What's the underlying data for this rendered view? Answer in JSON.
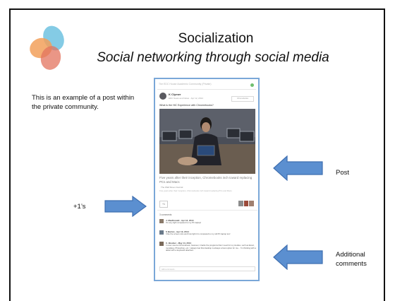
{
  "slide": {
    "title": "Socialization",
    "subtitle": "Social networking through social media",
    "description": "This is an example of a post within the private community.",
    "labels": {
      "post": "Post",
      "plus_ones": "+1’s",
      "additional_comments_line1": "Additional",
      "additional_comments_line2": "comments"
    },
    "colors": {
      "arrow_fill": "#5b8fd0",
      "arrow_stroke": "#3f6fb0",
      "panel_border": "#7aa7d8",
      "logo_blue": "#6fc2e0",
      "logo_orange": "#f2a05a",
      "logo_red": "#e3735e"
    }
  },
  "post_screenshot": {
    "community_header": "The EDC House Academic Community (Private)",
    "author_name": "K Clymer",
    "author_meta": "EDC News and Notes · Apr 12, 2014",
    "category_badge": "Chromebooks",
    "question": "What is the HiC Experience with Chromebooks?",
    "caption": "Five years after their inception, Chromebooks inch toward replacing PCs and Macs",
    "link_text": "The Wall Street Journal",
    "link_description": "Five years after their inception, Chromebooks inch toward replacing PCs and Macs",
    "plus_one": "+1",
    "comments_count": "3 comments",
    "comments": [
      {
        "name": "J. MacDonald · Apr 13, 2014",
        "text": "It's very light compared to my PC laptop!"
      },
      {
        "name": "S Barton · Apr 13, 2014",
        "text": "I like the screen size and how light it is compared to my old PC laptop too!"
      },
      {
        "name": "C. Brecker · May 14, 2014",
        "text": "I never used a Chromebook, however, it lacks the programs that I need for my studies, such as Excel, mendeley, Photoshop, etc. I always feel that desktop is always a best option for me... I'm thinking with a tablet with a keyboard attached."
      }
    ],
    "comment_placeholder": "Add a comment..."
  }
}
